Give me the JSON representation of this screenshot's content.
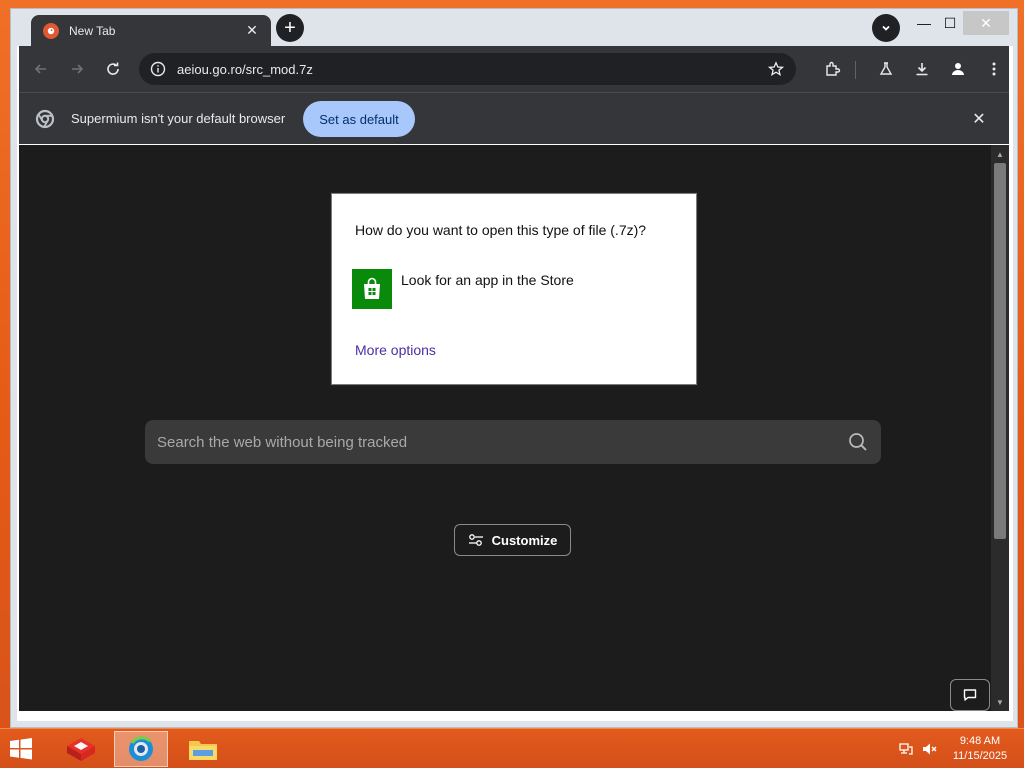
{
  "browser": {
    "tab": {
      "title": "New Tab",
      "close_glyph": "✕"
    },
    "new_tab_glyph": "+",
    "window_controls": {
      "minimize": "—",
      "maximize": "☐",
      "close": "✕"
    },
    "address": {
      "url": "aeiou.go.ro/src_mod.7z"
    }
  },
  "infobar": {
    "message": "Supermium isn't your default browser",
    "button_label": "Set as default",
    "close_glyph": "✕"
  },
  "page": {
    "search_placeholder": "Search the web without being tracked",
    "customize_label": "Customize"
  },
  "dialog": {
    "title": "How do you want to open this type of file (.7z)?",
    "store_option": "Look for an app in the Store",
    "more_options": "More options"
  },
  "taskbar": {
    "clock_time": "9:48 AM",
    "clock_date": "11/15/2025"
  },
  "colors": {
    "accent_button": "#a8c7fa",
    "store_green": "#0a8a0a",
    "link_purple": "#4b2ea3",
    "taskbar_orange": "#d4501a"
  },
  "icons": [
    "duckduckgo-icon",
    "back-arrow-icon",
    "forward-arrow-icon",
    "reload-icon",
    "site-info-icon",
    "star-icon",
    "extensions-icon",
    "labs-flask-icon",
    "download-icon",
    "profile-icon",
    "kebab-menu-icon",
    "chrome-icon",
    "search-icon",
    "sliders-icon",
    "chat-bubble-icon",
    "windows-logo-icon",
    "store-bag-icon",
    "network-icon",
    "volume-muted-icon"
  ]
}
